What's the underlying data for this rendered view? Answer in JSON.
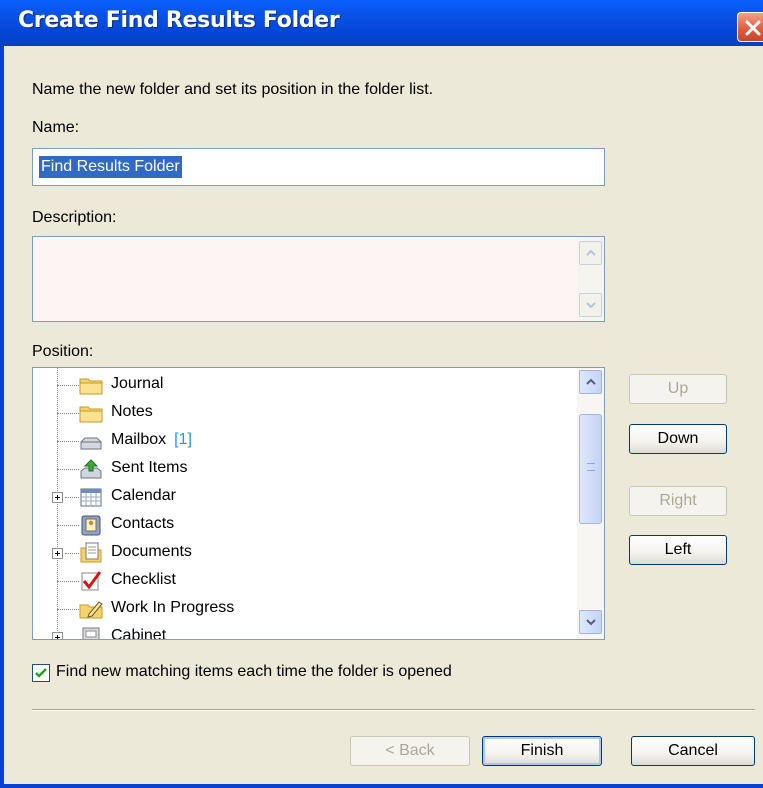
{
  "dialog": {
    "title": "Create Find Results Folder",
    "instruction": "Name the new folder and set its position in the folder list."
  },
  "name_field": {
    "label": "Name:",
    "value": "Find Results Folder"
  },
  "description_field": {
    "label": "Description:",
    "value": ""
  },
  "position": {
    "label": "Position:",
    "items": [
      {
        "label": "Journal",
        "icon": "folder-icon",
        "badge": ""
      },
      {
        "label": "Notes",
        "icon": "folder-icon",
        "badge": ""
      },
      {
        "label": "Mailbox",
        "icon": "mailbox-icon",
        "badge": "[1]"
      },
      {
        "label": "Sent Items",
        "icon": "sent-items-icon",
        "badge": ""
      },
      {
        "label": "Calendar",
        "icon": "calendar-icon",
        "badge": ""
      },
      {
        "label": "Contacts",
        "icon": "contacts-icon",
        "badge": ""
      },
      {
        "label": "Documents",
        "icon": "documents-icon",
        "badge": ""
      },
      {
        "label": "Checklist",
        "icon": "checklist-icon",
        "badge": ""
      },
      {
        "label": "Work In Progress",
        "icon": "work-in-progress-icon",
        "badge": ""
      },
      {
        "label": "Cabinet",
        "icon": "cabinet-icon",
        "badge": ""
      }
    ]
  },
  "side_buttons": {
    "up": "Up",
    "down": "Down",
    "right": "Right",
    "left": "Left"
  },
  "option": {
    "label": "Find new matching items each time the folder is opened",
    "checked": true
  },
  "footer": {
    "back": "< Back",
    "finish": "Finish",
    "cancel": "Cancel"
  },
  "colors": {
    "titlebar": "#0a53e8",
    "dialog_bg": "#ece9d8",
    "selection": "#316ac5",
    "badge": "#1c9bd6"
  }
}
